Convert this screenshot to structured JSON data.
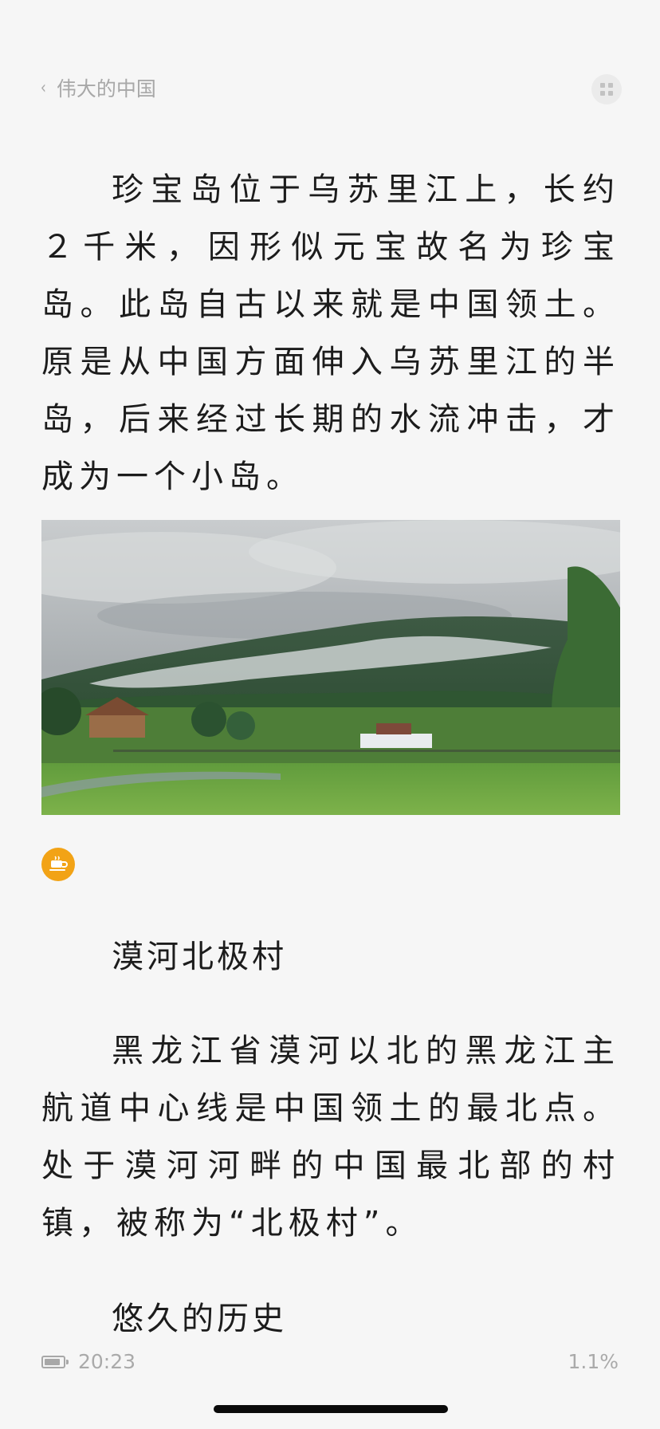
{
  "header": {
    "back_label": "伟大的中国",
    "back_icon": "chevron-left-icon",
    "menu_icon": "grid-icon"
  },
  "article": {
    "paragraph_1": "珍宝岛位于乌苏里江上，长约２千米，因形似元宝故名为珍宝岛。此岛自古以来就是中国领土。原是从中国方面伸入乌苏里江的半岛，后来经过长期的水流冲击，才成为一个小岛。",
    "image_icon": "landscape-photo",
    "coffee_icon": "coffee-cup-icon",
    "heading_1": "漠河北极村",
    "paragraph_2": "黑龙江省漠河以北的黑龙江主航道中心线是中国领土的最北点。处于漠河河畔的中国最北部的村镇，被称为“北极村”。",
    "heading_2": "悠久的历史"
  },
  "status": {
    "time": "20:23",
    "progress": "1.1%",
    "battery_level": 0.85,
    "battery_icon": "battery-icon"
  },
  "colors": {
    "background": "#f6f6f6",
    "text": "#1c1c1c",
    "muted": "#a8a8a8",
    "accent": "#f2a316"
  }
}
